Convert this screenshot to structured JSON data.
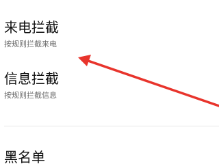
{
  "settings": {
    "items": [
      {
        "title": "来电拦截",
        "description": "按规则拦截来电"
      },
      {
        "title": "信息拦截",
        "description": "按规则拦截信息"
      },
      {
        "title": "黑名单"
      }
    ]
  },
  "annotation": {
    "arrow_color": "#e8342c"
  }
}
